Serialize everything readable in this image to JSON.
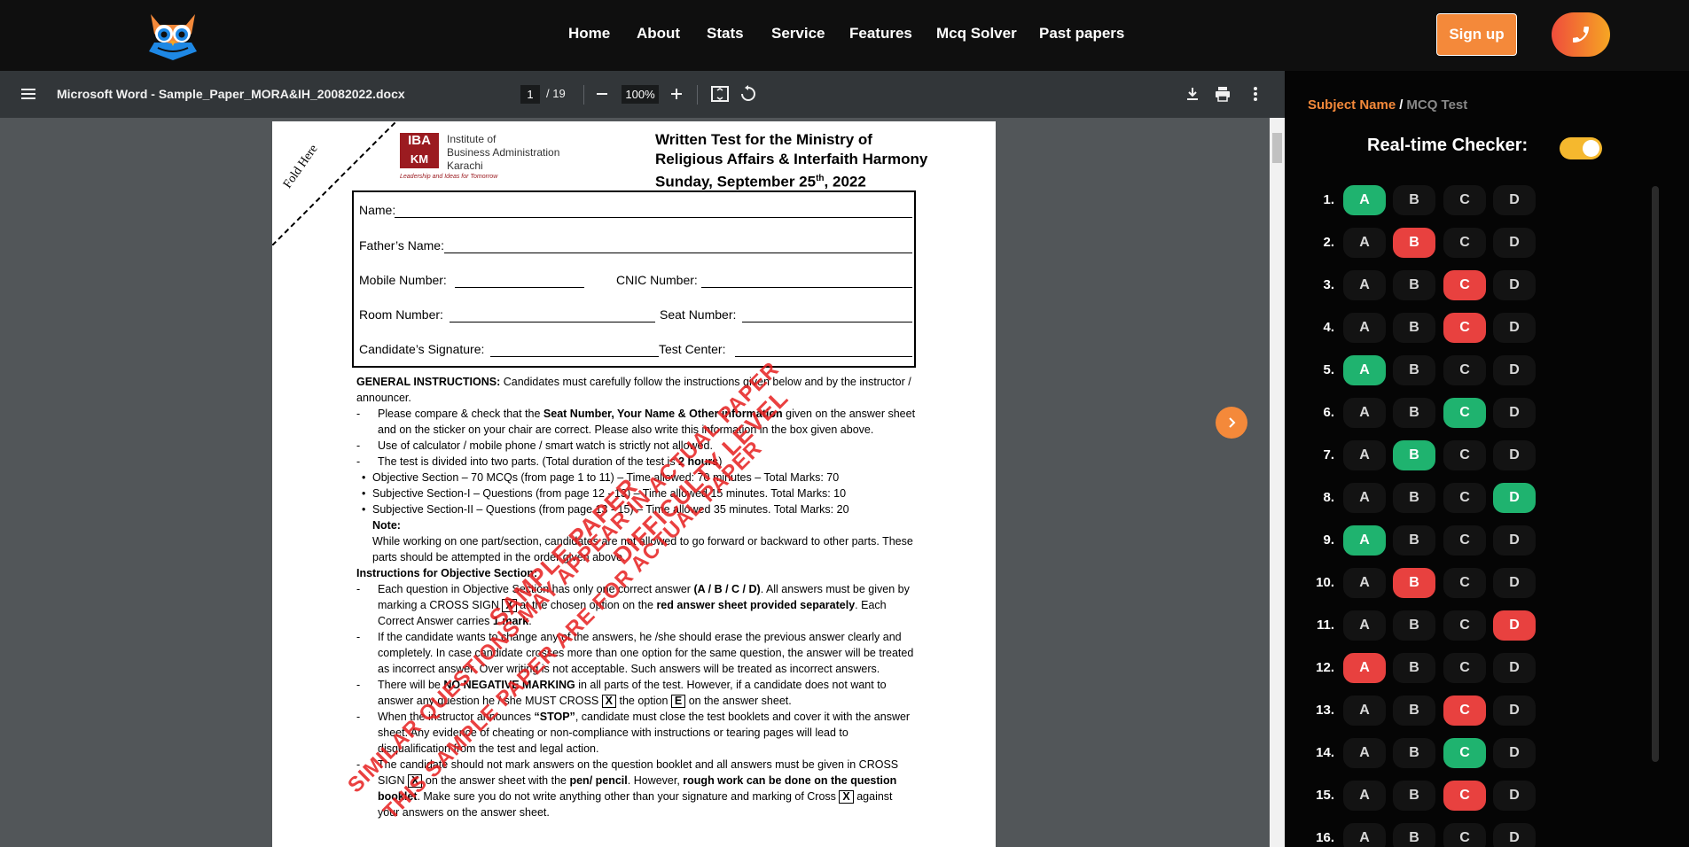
{
  "nav": {
    "links": [
      "Home",
      "About",
      "Stats",
      "Service",
      "Features",
      "Mcq Solver",
      "Past papers"
    ],
    "signup_label": "Sign up",
    "phone_icon": "phone-icon"
  },
  "pdf": {
    "title": "Microsoft Word - Sample_Paper_MORA&IH_20082022.docx",
    "page_current": "1",
    "page_total": "/ 19",
    "zoom": "100%",
    "icons": [
      "menu-icon",
      "zoom-out-icon",
      "zoom-in-icon",
      "fit-page-icon",
      "rotate-icon",
      "download-icon",
      "print-icon",
      "more-icon"
    ]
  },
  "document": {
    "fold_text": "Fold Here",
    "iba_logo_top": "IBA",
    "iba_logo_bottom": "KM",
    "iba_name": "Institute of\nBusiness Administration\nKarachi",
    "iba_tagline": "Leadership and Ideas for Tomorrow",
    "title_line1": "Written Test for the Ministry of",
    "title_line2": "Religious Affairs & Interfaith Harmony",
    "title_line3_pre": "Sunday, September 25",
    "title_line3_sup": "th",
    "title_line3_post": ", 2022",
    "fields": {
      "name": "Name:",
      "father": "Father’s Name:",
      "mobile": "Mobile Number:",
      "cnic": "CNIC Number:",
      "room": "Room Number:",
      "seat": "Seat Number:",
      "signature": "Candidate’s Signature:",
      "center": "Test Center:"
    },
    "general_heading": "GENERAL INSTRUCTIONS:",
    "general_intro": " Candidates must carefully follow the instructions given below and by the instructor / announcer.",
    "g1_pre": "Please compare & check that the ",
    "g1_bold": "Seat Number, Your Name & Other information",
    "g1_post": " given on the answer sheet and on the sticker on your chair are correct. Please also write this information in the box given above.",
    "g2": "Use of calculator / mobile phone / smart watch is strictly not allowed.",
    "g3_pre": "The test is divided into two parts. (Total duration of the test is ",
    "g3_bold": "2 hours",
    "g3_post": ")",
    "b1": "Objective Section – 70 MCQs  (from page 1 to 11) – Time allowed: 70 minutes – Total Marks: 70",
    "b2": "Subjective Section-I –  Questions (from page 12 - 13) – Time allowed 15 minutes. Total Marks: 10",
    "b3": "Subjective Section-II –  Questions (from page 13 - 15) – Time allowed 35 minutes. Total Marks: 20",
    "note_heading": "Note:",
    "note_text": "While working on one part/section, candidates are not allowed to go forward or backward to other parts. These parts should be attempted in the order given above.",
    "obj_heading": "Instructions for Objective Section:",
    "o1_pre": "Each question in Objective Section has only one correct answer ",
    "o1_bold": "(A / B / C / D)",
    "o1_mid": ". All answers must be given by marking a CROSS SIGN ",
    "o1_x": "X",
    "o1_mid2": " at the chosen option on the ",
    "o1_bold2": "red answer sheet provided separately",
    "o1_mid3": ". Each Correct Answer carries ",
    "o1_bold3": "1 mark",
    "o1_post": ".",
    "o2": "If the candidate wants to change any of the answers, he /she should erase the previous answer clearly and completely. In case candidate crosses more than one option for the same question, the answer will be treated as incorrect answer. Over writing is not acceptable. Such answers will be treated as incorrect answers.",
    "o3_pre": "There will be ",
    "o3_bold": "NO NEGATIVE MARKING",
    "o3_mid": " in all parts of the test. However, if a candidate does not want to answer any question he / she MUST CROSS ",
    "o3_x": "X",
    "o3_mid2": " the option ",
    "o3_e": "E",
    "o3_post": " on the answer sheet.",
    "o4_pre": "When the instructor announces ",
    "o4_bold": "“STOP”",
    "o4_post": ", candidate must close the test booklets and cover it with the answer sheet. Any evidence of cheating or non-compliance with instructions or tearing pages will lead to disqualification from the test and legal action.",
    "o5_pre": "The candidate should not mark answers on the question booklet and all answers must be given in CROSS SIGN ",
    "o5_x": "X",
    "o5_mid": " on the answer sheet with the ",
    "o5_bold": "pen/ pencil",
    "o5_mid2": ". However, ",
    "o5_bold2": "rough work can be done on the question booklet",
    "o5_mid3": ". Make sure you do not write anything other than your signature and marking of Cross ",
    "o5_x2": "X",
    "o5_post": " against your answers on the answer sheet.",
    "watermark_lines": [
      "SAMPLE PAPER",
      "DIFFICULTY LEVEL",
      "SIMILAR QUESTIONS MAY APPEAR IN ACTUAL PAPER",
      "THIS SAMPLE PAPER ARE FOR ACTUAL PAPER"
    ]
  },
  "panel": {
    "subject_name": "Subject Name",
    "slash": "/",
    "mcq_test": "MCQ Test",
    "realtime_label": "Real-time Checker:",
    "toggle_on": true,
    "options": [
      "A",
      "B",
      "C",
      "D"
    ],
    "questions": [
      {
        "num": "1.",
        "selected": "A",
        "status": "correct"
      },
      {
        "num": "2.",
        "selected": "B",
        "status": "wrong"
      },
      {
        "num": "3.",
        "selected": "C",
        "status": "wrong"
      },
      {
        "num": "4.",
        "selected": "C",
        "status": "wrong"
      },
      {
        "num": "5.",
        "selected": "A",
        "status": "correct"
      },
      {
        "num": "6.",
        "selected": "C",
        "status": "correct"
      },
      {
        "num": "7.",
        "selected": "B",
        "status": "correct"
      },
      {
        "num": "8.",
        "selected": "D",
        "status": "correct"
      },
      {
        "num": "9.",
        "selected": "A",
        "status": "correct"
      },
      {
        "num": "10.",
        "selected": "B",
        "status": "wrong"
      },
      {
        "num": "11.",
        "selected": "D",
        "status": "wrong"
      },
      {
        "num": "12.",
        "selected": "A",
        "status": "wrong"
      },
      {
        "num": "13.",
        "selected": "C",
        "status": "wrong"
      },
      {
        "num": "14.",
        "selected": "C",
        "status": "correct"
      },
      {
        "num": "15.",
        "selected": "C",
        "status": "wrong"
      },
      {
        "num": "16.",
        "selected": "",
        "status": ""
      }
    ],
    "colors": {
      "correct": "#1fb36f",
      "wrong": "#e8413f",
      "accent": "#f4893a"
    }
  }
}
